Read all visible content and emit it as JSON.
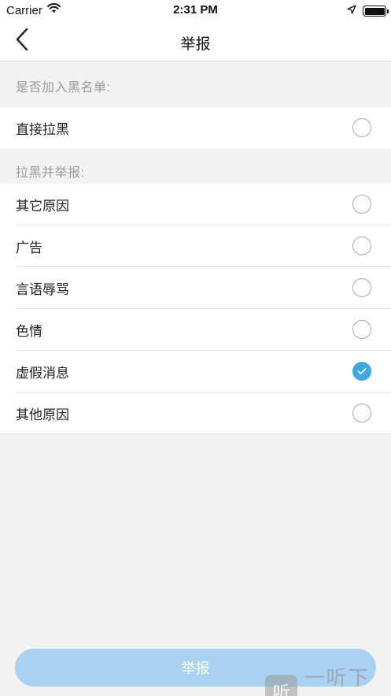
{
  "status_bar": {
    "carrier": "Carrier",
    "time": "2:31 PM"
  },
  "nav": {
    "title": "举报"
  },
  "blacklist_section": {
    "header": "是否加入黑名单:",
    "items": [
      {
        "label": "直接拉黑",
        "checked": false
      }
    ]
  },
  "report_section": {
    "header": "拉黑并举报:",
    "items": [
      {
        "label": "其它原因",
        "checked": false
      },
      {
        "label": "广告",
        "checked": false
      },
      {
        "label": "言语辱骂",
        "checked": false
      },
      {
        "label": "色情",
        "checked": false
      },
      {
        "label": "虚假消息",
        "checked": true
      },
      {
        "label": "其他原因",
        "checked": false
      }
    ]
  },
  "submit": {
    "label": "举报"
  },
  "watermark": {
    "text": "一听下载",
    "logo": "听"
  },
  "colors": {
    "accent": "#3fa7e1",
    "button": "#a8d2f0"
  }
}
